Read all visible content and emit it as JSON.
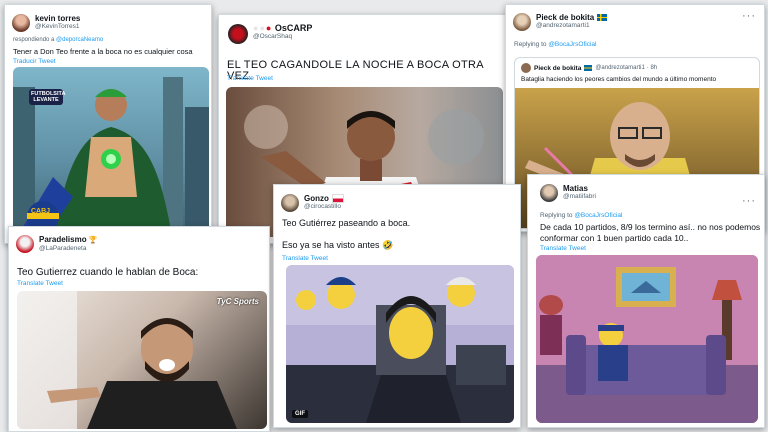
{
  "tweets": [
    {
      "name": "kevin torres",
      "handle": "@KevinTorres1",
      "reply_prefix": "respondiendo a ",
      "reply_to": "@deporcaNeamo",
      "text": "Tener a Don Teo frente a la boca no es cualquier cosa",
      "translate": "Traducir Tweet",
      "image": {
        "badge_text": "FUTBOLSITA LEVANTE",
        "emblem_text": "CABJ"
      }
    },
    {
      "name": "OsCARP",
      "handle": "@OscarShaq",
      "text": "EL TEO CAGANDOLE LA NOCHE A BOCA OTRA VEZ.",
      "translate": "Translate Tweet"
    },
    {
      "name": "Pieck de bokita",
      "handle": "@andrezotamarti1",
      "reply_prefix": "Replying to ",
      "reply_to": "@BocaJrsOficial",
      "quoted": {
        "name": "Pieck de bokita",
        "handle": "@andrezotamarti1",
        "time": "· 8h",
        "text": "Bataglia haciendo los peores cambios del mundo a último momento"
      }
    },
    {
      "name": "Paradelismo",
      "handle": "@LaParadeneta",
      "text": "Teo Gutierrez cuando le hablan de Boca:",
      "translate": "Translate Tweet",
      "image": {
        "logo_text": "TyC Sports"
      }
    },
    {
      "name": "Gonzo",
      "handle": "@cirocastillo",
      "text_line1": "Teo Gutiérrez paseando a boca.",
      "text_line2": "Eso ya se ha visto antes 🤣",
      "translate": "Translate Tweet",
      "image": {
        "gif_label": "GIF"
      }
    },
    {
      "name": "Matias",
      "handle": "@matiifabri",
      "reply_prefix": "Replying to ",
      "reply_to": "@BocaJrsOficial",
      "text": "De cada 10 partidos, 8/9 los termino así.. no nos podemos conformar con 1 buen partido cada 10..",
      "translate": "Translate Tweet"
    }
  ]
}
